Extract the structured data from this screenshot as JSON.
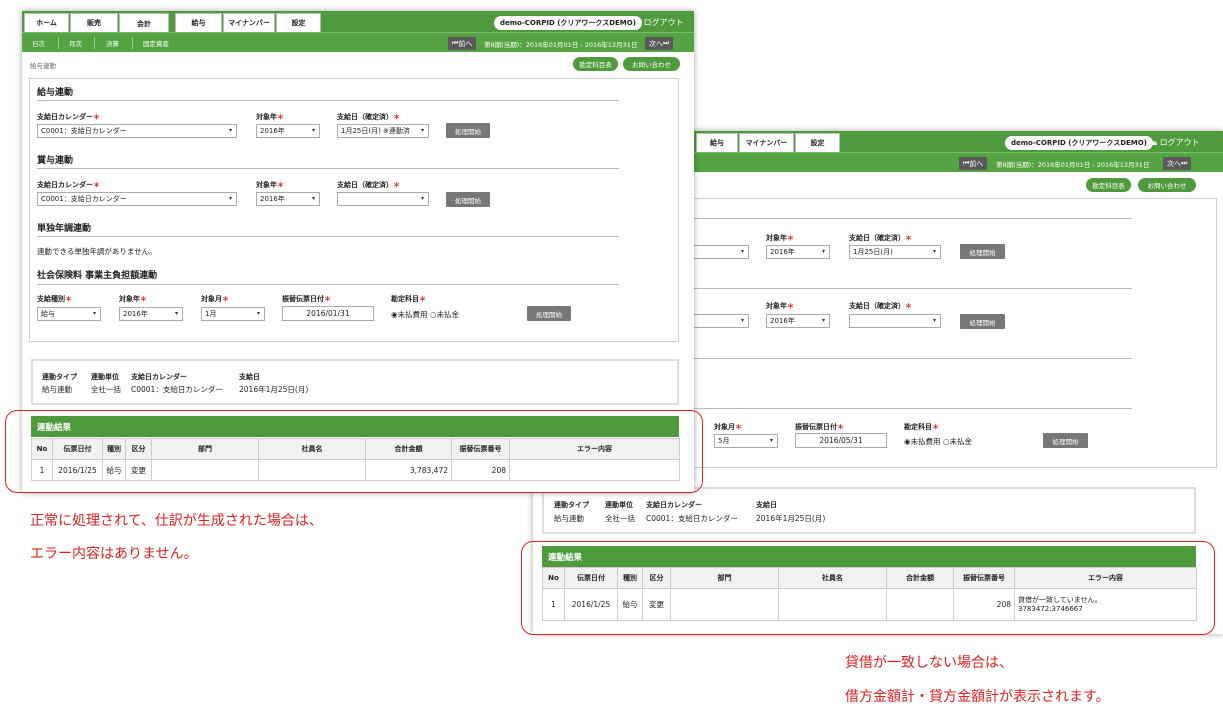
{
  "back": {
    "tabs": [
      "給与",
      "マイナンバー",
      "設定"
    ],
    "company": "demo-CORPID (クリアワークスDEMO)",
    "logout": "ログアウト",
    "prev": "前へ",
    "period": "第8期(当期)：2016年01月01日 - 2016年12月31日",
    "next": "次へ",
    "btn_accounts": "勘定科目表",
    "btn_contact": "お問い合わせ",
    "form": {
      "target_year_label": "対象年",
      "pay_date_label": "支給日（確定済）",
      "target_year_1": "2016年",
      "pay_date_1": "1月25日(月)",
      "process_label": "処理開始",
      "target_year_2": "2016年",
      "pay_date_2": "",
      "target_month_label": "対象月",
      "target_month": "5月",
      "transfer_date_label": "振替伝票日付",
      "transfer_date": "2016/05/31",
      "account_label": "勘定科目",
      "radio_unpaid_expense": "未払費用",
      "radio_unpaid": "未払金"
    },
    "info": {
      "headers": [
        "連動タイプ",
        "連動単位",
        "支給日カレンダー",
        "支給日"
      ],
      "values": [
        "給与連動",
        "全社一括",
        "C0001：支給日カレンダー",
        "2016年1月25日(月)"
      ]
    },
    "result": {
      "title": "連動結果",
      "columns": [
        "No",
        "伝票日付",
        "種別",
        "区分",
        "部門",
        "社員名",
        "合計金額",
        "振替伝票番号",
        "エラー内容"
      ],
      "row": {
        "no": "1",
        "date": "2016/1/25",
        "type": "給与",
        "kind": "変更",
        "dept": "",
        "employee": "",
        "total": "",
        "voucher": "208",
        "error_line1": "貸借が一致していません。",
        "error_line2": "3783472:3746667"
      }
    }
  },
  "front": {
    "tabs": [
      "ホーム",
      "販売",
      "会計",
      "給与",
      "マイナンバー",
      "設定"
    ],
    "company": "demo-CORPID (クリアワークスDEMO)",
    "logout": "ログアウト",
    "sub_links": [
      "日次",
      "月次",
      "決算",
      "固定資産"
    ],
    "prev": "前へ",
    "period": "第8期(当期)：2016年01月01日 - 2016年12月31日",
    "next": "次へ",
    "breadcrumb": "給与連動",
    "btn_accounts": "勘定科目表",
    "btn_contact": "お問い合わせ",
    "salary": {
      "title": "給与連動",
      "calendar_label": "支給日カレンダー",
      "calendar": "C0001：支給日カレンダー",
      "target_year_label": "対象年",
      "target_year": "2016年",
      "pay_date_label": "支給日（確定済）",
      "pay_date": "1月25日(月) ※連動済",
      "process": "処理開始"
    },
    "bonus": {
      "title": "賞与連動",
      "calendar_label": "支給日カレンダー",
      "calendar": "C0001：支給日カレンダー",
      "target_year_label": "対象年",
      "target_year": "2016年",
      "pay_date_label": "支給日（確定済）",
      "pay_date": "",
      "process": "処理開始"
    },
    "annual": {
      "title": "単独年調連動",
      "note": "連動できる単独年調がありません。"
    },
    "social": {
      "title": "社会保険料 事業主負担額連動",
      "kind_label": "支給種別",
      "kind": "給与",
      "target_year_label": "対象年",
      "target_year": "2016年",
      "target_month_label": "対象月",
      "target_month": "1月",
      "transfer_date_label": "振替伝票日付",
      "transfer_date": "2016/01/31",
      "account_label": "勘定科目",
      "radio_unpaid_expense": "未払費用",
      "radio_unpaid": "未払金",
      "process": "処理開始"
    },
    "info": {
      "headers": [
        "連動タイプ",
        "連動単位",
        "支給日カレンダー",
        "支給日"
      ],
      "values": [
        "給与連動",
        "全社一括",
        "C0001：支給日カレンダー",
        "2016年1月25日(月)"
      ]
    },
    "result": {
      "title": "連動結果",
      "columns": [
        "No",
        "伝票日付",
        "種別",
        "区分",
        "部門",
        "社員名",
        "合計金額",
        "振替伝票番号",
        "エラー内容"
      ],
      "row": {
        "no": "1",
        "date": "2016/1/25",
        "type": "給与",
        "kind": "変更",
        "dept": "",
        "employee": "",
        "total": "3,783,472",
        "voucher": "208",
        "error": ""
      }
    }
  },
  "captions": {
    "left_line1": "正常に処理されて、仕訳が生成された場合は、",
    "left_line2": "エラー内容はありません。",
    "right_line1": "貸借が一致しない場合は、",
    "right_line2": "借方金額計・貸方金額計が表示されます。"
  },
  "colors": {
    "green": "#4f9a3c",
    "annotation_red": "#e02020"
  }
}
